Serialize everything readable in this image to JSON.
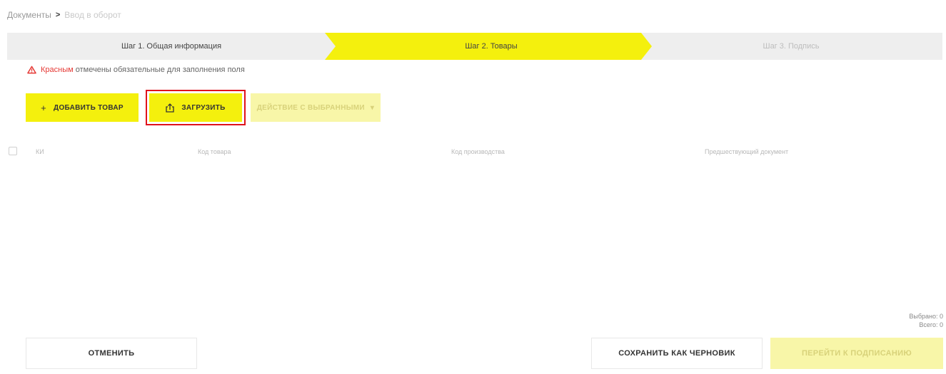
{
  "breadcrumb": {
    "root": "Документы",
    "separator": ">",
    "current": "Ввод в оборот"
  },
  "stepper": {
    "step1": "Шаг 1. Общая информация",
    "step2": "Шаг 2. Товары",
    "step3": "Шаг 3. Подпись"
  },
  "notice": {
    "red_word": "Красным",
    "rest": "отмечены обязательные для заполнения поля"
  },
  "toolbar": {
    "add_label": "ДОБАВИТЬ ТОВАР",
    "add_icon": "+",
    "upload_label": "ЗАГРУЗИТЬ",
    "action_label": "ДЕЙСТВИЕ С ВЫБРАННЫМИ",
    "action_chevron": "▾"
  },
  "table": {
    "columns": [
      "КИ",
      "Код товара",
      "Код производства",
      "Предшествующий документ"
    ]
  },
  "counters": {
    "selected": "Выбрано: 0",
    "total": "Всего: 0"
  },
  "footer": {
    "cancel_label": "ОТМЕНИТЬ",
    "draft_label": "СОХРАНИТЬ КАК ЧЕРНОВИК",
    "sign_label": "ПЕРЕЙТИ К ПОДПИСАНИЮ"
  },
  "colors": {
    "accent": "#f4f00d",
    "accent_disabled": "#f8f6a8",
    "highlight_border": "#e0121b",
    "warning": "#e53935"
  }
}
